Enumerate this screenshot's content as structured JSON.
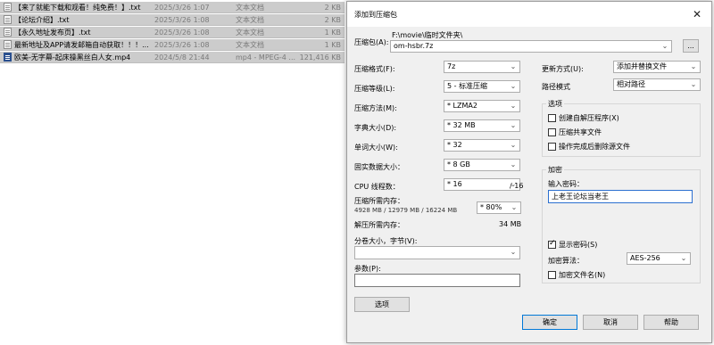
{
  "files": [
    {
      "name": "【来了就能下载和观看！纯免费！】.txt",
      "date": "2025/3/26 1:07",
      "type": "文本文档",
      "size": "2 KB",
      "icon": "text-file-icon"
    },
    {
      "name": "【论坛介绍】.txt",
      "date": "2025/3/26 1:08",
      "type": "文本文档",
      "size": "2 KB",
      "icon": "text-file-icon"
    },
    {
      "name": "【永久地址发布页】.txt",
      "date": "2025/3/26 1:08",
      "type": "文本文档",
      "size": "1 KB",
      "icon": "text-file-icon"
    },
    {
      "name": "最新地址及APP请发邮箱自动获取！！！...",
      "date": "2025/3/26 1:08",
      "type": "文本文档",
      "size": "1 KB",
      "icon": "text-file-icon"
    },
    {
      "name": "欧美-无字幕-起床操黑丝白人女.mp4",
      "date": "2024/5/8 21:44",
      "type": "mp4 - MPEG-4 ...",
      "size": "121,416 KB",
      "icon": "video-file-icon"
    }
  ],
  "dialog": {
    "title": "添加到压缩包",
    "close_glyph": "✕",
    "archive": {
      "label": "压缩包(A):",
      "folder": "F:\\movie\\临时文件夹\\",
      "value": "om-hsbr.7z",
      "browse_label": "..."
    },
    "left": {
      "format": {
        "label": "压缩格式(F):",
        "value": "7z"
      },
      "level": {
        "label": "压缩等级(L):",
        "value": "5 - 标准压缩"
      },
      "method": {
        "label": "压缩方法(M):",
        "value": "* LZMA2"
      },
      "dict": {
        "label": "字典大小(D):",
        "value": "* 32 MB"
      },
      "word": {
        "label": "单词大小(W):",
        "value": "* 32"
      },
      "solid": {
        "label": "固实数据大小：",
        "value": "* 8 GB"
      },
      "threads": {
        "label": "CPU 线程数：",
        "value": "* 16",
        "max": "/ 16"
      },
      "mem_comp": {
        "label": "压缩所需内存：",
        "detail": "4928 MB / 12979 MB / 16224 MB",
        "percent": "* 80%"
      },
      "mem_decomp": {
        "label": "解压所需内存：",
        "value": "34 MB"
      },
      "volume": {
        "label": "分卷大小，字节(V):",
        "value": ""
      },
      "params": {
        "label": "参数(P):",
        "value": ""
      },
      "options_button": "选项"
    },
    "right": {
      "update_mode": {
        "label": "更新方式(U):",
        "value": "添加并替换文件"
      },
      "path_mode": {
        "label": "路径模式",
        "value": "相对路径"
      },
      "options": {
        "title": "选项",
        "sfx": {
          "label": "创建自解压程序(X)",
          "checked": false
        },
        "shared": {
          "label": "压缩共享文件",
          "checked": false
        },
        "delete": {
          "label": "操作完成后删除源文件",
          "checked": false
        }
      },
      "encryption": {
        "title": "加密",
        "password_label": "输入密码：",
        "password_value": "上老王论坛当老王",
        "show_password": {
          "label": "显示密码(S)",
          "checked": true
        },
        "method_label": "加密算法：",
        "method_value": "AES-256",
        "encrypt_names": {
          "label": "加密文件名(N)",
          "checked": false
        }
      }
    },
    "buttons": {
      "ok": "确定",
      "cancel": "取消",
      "help": "帮助"
    }
  },
  "colors": {
    "dialog_bg": "#f0f0f0",
    "selected_row": "#cccccc",
    "accent": "#0078d7"
  }
}
